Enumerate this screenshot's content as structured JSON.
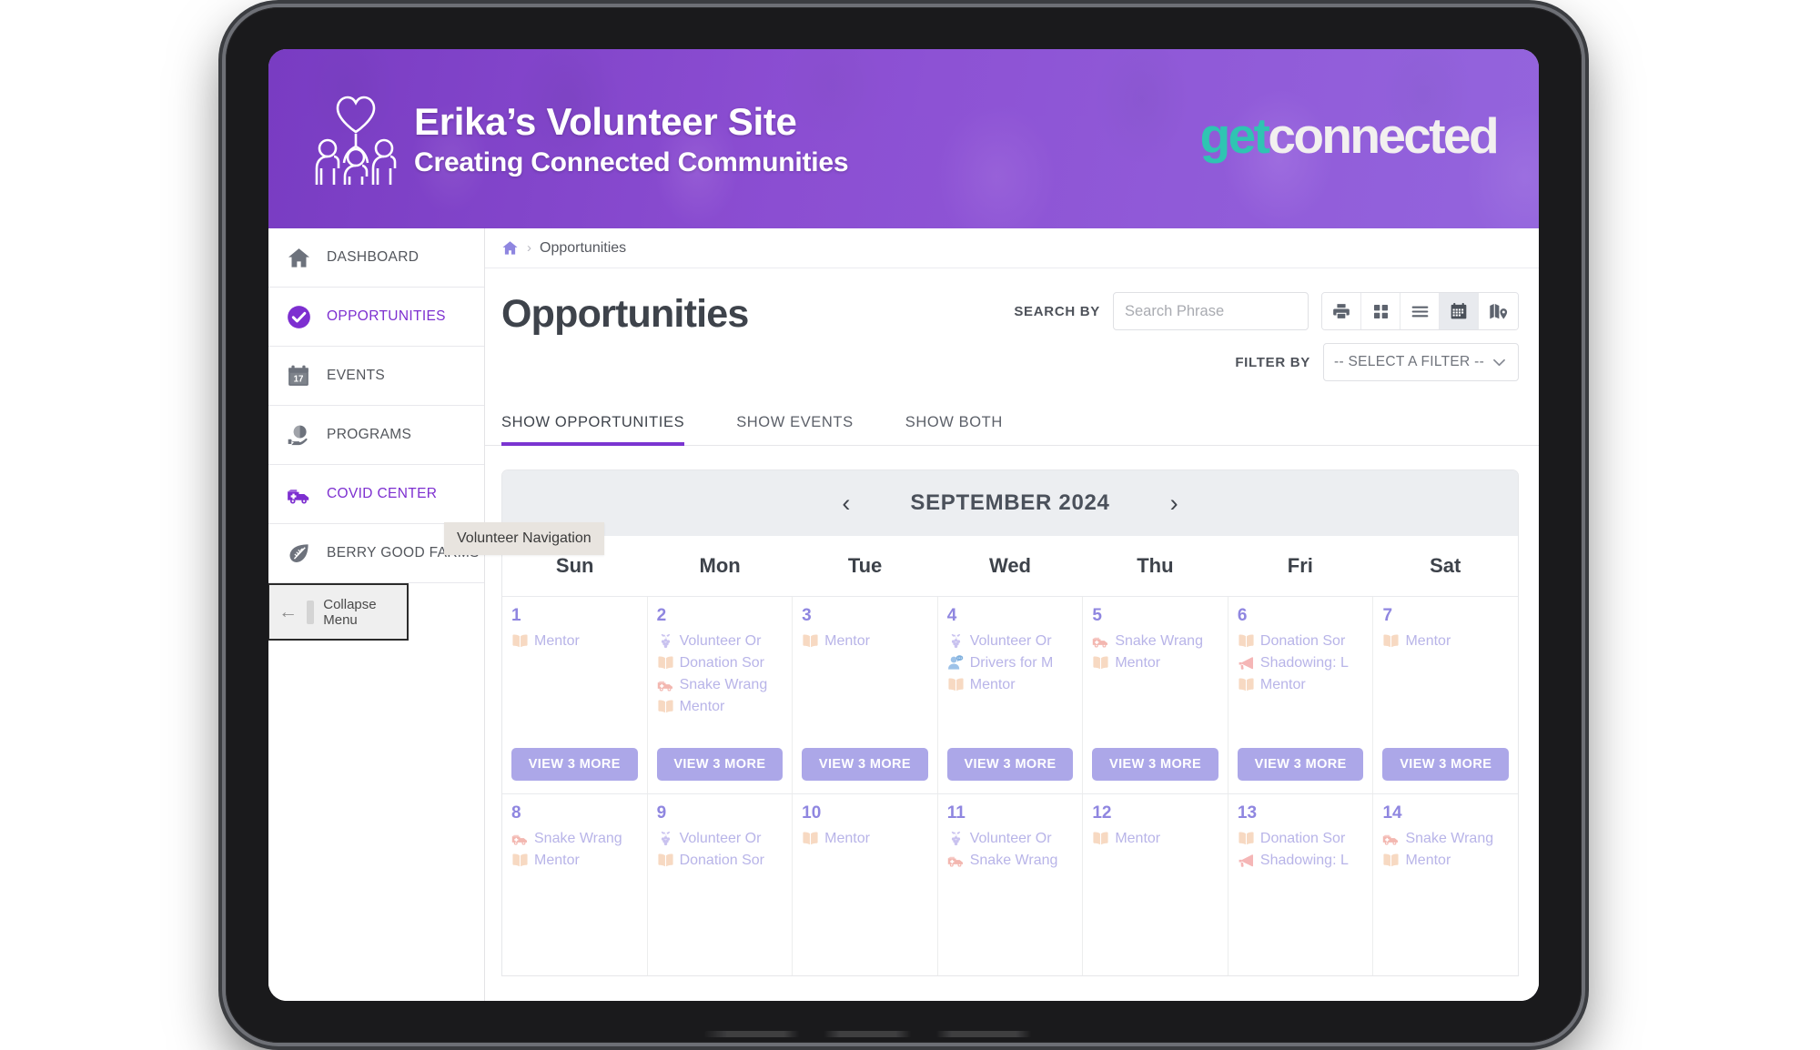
{
  "banner": {
    "site_title": "Erika’s Volunteer Site",
    "tagline": "Creating Connected Communities",
    "logo_icon": "family-heart-icon",
    "brand_get": "get",
    "brand_connected": "connected",
    "colors": {
      "brand_teal": "#2fc4b2",
      "banner_purple": "#8f4fd6"
    }
  },
  "sidebar": {
    "items": [
      {
        "label": "DASHBOARD",
        "icon": "home-icon",
        "state": "default"
      },
      {
        "label": "OPPORTUNITIES",
        "icon": "check-circle-icon",
        "state": "active"
      },
      {
        "label": "EVENTS",
        "icon": "calendar-17-icon",
        "state": "default"
      },
      {
        "label": "PROGRAMS",
        "icon": "globe-hand-icon",
        "state": "default"
      },
      {
        "label": "COVID CENTER",
        "icon": "ambulance-icon",
        "state": "accent"
      },
      {
        "label": "BERRY GOOD FARMS",
        "icon": "leaf-icon",
        "state": "default"
      }
    ],
    "collapse_button": {
      "label": "Collapse Menu",
      "icon": "arrow-left-icon"
    },
    "tooltip": "Volunteer Navigation"
  },
  "breadcrumb": {
    "home_icon": "home-icon",
    "separator": "›",
    "current": "Opportunities"
  },
  "page": {
    "title": "Opportunities"
  },
  "search": {
    "label": "SEARCH BY",
    "placeholder": "Search Phrase",
    "value": ""
  },
  "filter": {
    "label": "FILTER BY",
    "selected": "-- SELECT A FILTER --"
  },
  "view_toolbar": {
    "buttons": [
      {
        "name": "print-icon",
        "active": false
      },
      {
        "name": "grid-view-icon",
        "active": false
      },
      {
        "name": "list-view-icon",
        "active": false
      },
      {
        "name": "calendar-view-icon",
        "active": true
      },
      {
        "name": "map-view-icon",
        "active": false
      }
    ]
  },
  "tabs": [
    {
      "label": "SHOW OPPORTUNITIES",
      "active": true
    },
    {
      "label": "SHOW EVENTS",
      "active": false
    },
    {
      "label": "SHOW BOTH",
      "active": false
    }
  ],
  "calendar": {
    "prev_label": "‹",
    "next_label": "›",
    "month_label": "SEPTEMBER 2024",
    "weekdays": [
      "Sun",
      "Mon",
      "Tue",
      "Wed",
      "Thu",
      "Fri",
      "Sat"
    ],
    "view_more_label": "VIEW 3 MORE",
    "weeks": [
      [
        {
          "day": "1",
          "events": [
            {
              "icon": "book-icon",
              "title": "Mentor"
            }
          ],
          "view_more": "VIEW 3 MORE"
        },
        {
          "day": "2",
          "events": [
            {
              "icon": "grapes-icon",
              "title": "Volunteer Or"
            },
            {
              "icon": "book-icon",
              "title": "Donation Sor"
            },
            {
              "icon": "ambulance-icon",
              "title": "Snake Wrang"
            },
            {
              "icon": "book-icon",
              "title": "Mentor"
            }
          ],
          "view_more": "VIEW 3 MORE"
        },
        {
          "day": "3",
          "events": [
            {
              "icon": "book-icon",
              "title": "Mentor"
            }
          ],
          "view_more": "VIEW 3 MORE"
        },
        {
          "day": "4",
          "events": [
            {
              "icon": "grapes-icon",
              "title": "Volunteer Or"
            },
            {
              "icon": "person-speech-icon",
              "title": "Drivers for M"
            },
            {
              "icon": "book-icon",
              "title": "Mentor"
            }
          ],
          "view_more": "VIEW 3 MORE"
        },
        {
          "day": "5",
          "events": [
            {
              "icon": "ambulance-icon",
              "title": "Snake Wrang"
            },
            {
              "icon": "book-icon",
              "title": "Mentor"
            }
          ],
          "view_more": "VIEW 3 MORE"
        },
        {
          "day": "6",
          "events": [
            {
              "icon": "book-icon",
              "title": "Donation Sor"
            },
            {
              "icon": "megaphone-icon",
              "title": "Shadowing: L"
            },
            {
              "icon": "book-icon",
              "title": "Mentor"
            }
          ],
          "view_more": "VIEW 3 MORE"
        },
        {
          "day": "7",
          "events": [
            {
              "icon": "book-icon",
              "title": "Mentor"
            }
          ],
          "view_more": "VIEW 3 MORE"
        }
      ],
      [
        {
          "day": "8",
          "events": [
            {
              "icon": "ambulance-icon",
              "title": "Snake Wrang"
            },
            {
              "icon": "book-icon",
              "title": "Mentor"
            }
          ],
          "view_more": ""
        },
        {
          "day": "9",
          "events": [
            {
              "icon": "grapes-icon",
              "title": "Volunteer Or"
            },
            {
              "icon": "book-icon",
              "title": "Donation Sor"
            }
          ],
          "view_more": ""
        },
        {
          "day": "10",
          "events": [
            {
              "icon": "book-icon",
              "title": "Mentor"
            }
          ],
          "view_more": ""
        },
        {
          "day": "11",
          "events": [
            {
              "icon": "grapes-icon",
              "title": "Volunteer Or"
            },
            {
              "icon": "ambulance-icon",
              "title": "Snake Wrang"
            }
          ],
          "view_more": ""
        },
        {
          "day": "12",
          "events": [
            {
              "icon": "book-icon",
              "title": "Mentor"
            }
          ],
          "view_more": ""
        },
        {
          "day": "13",
          "events": [
            {
              "icon": "book-icon",
              "title": "Donation Sor"
            },
            {
              "icon": "megaphone-icon",
              "title": "Shadowing: L"
            }
          ],
          "view_more": ""
        },
        {
          "day": "14",
          "events": [
            {
              "icon": "ambulance-icon",
              "title": "Snake Wrang"
            },
            {
              "icon": "book-icon",
              "title": "Mentor"
            }
          ],
          "view_more": ""
        }
      ]
    ]
  }
}
